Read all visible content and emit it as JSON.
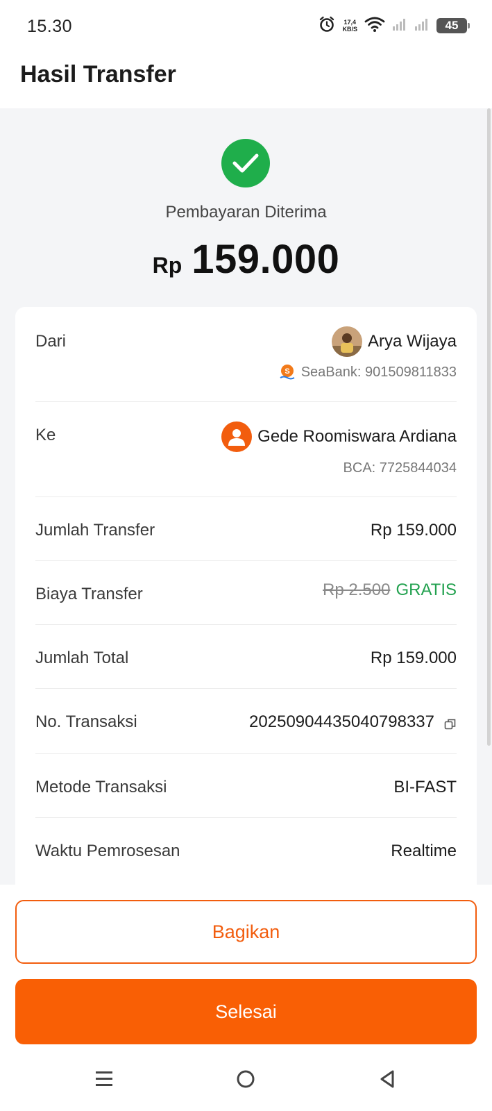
{
  "status_bar": {
    "time": "15.30",
    "net_speed_value": "17,4",
    "net_speed_unit": "KB/S",
    "battery": "45"
  },
  "header": {
    "title": "Hasil Transfer"
  },
  "summary": {
    "status_text": "Pembayaran Diterima",
    "currency": "Rp",
    "amount": "159.000",
    "status_color": "#1fae4b"
  },
  "details": {
    "from": {
      "label": "Dari",
      "name": "Arya Wijaya",
      "account": "SeaBank: 901509811833"
    },
    "to": {
      "label": "Ke",
      "name": "Gede Roomiswara Ardiana",
      "account": "BCA: 7725844034"
    },
    "transfer_amount": {
      "label": "Jumlah Transfer",
      "value": "Rp 159.000"
    },
    "transfer_fee": {
      "label": "Biaya Transfer",
      "original": "Rp 2.500",
      "value": "GRATIS"
    },
    "total_amount": {
      "label": "Jumlah Total",
      "value": "Rp 159.000"
    },
    "transaction_no": {
      "label": "No. Transaksi",
      "value": "20250904435040798337"
    },
    "method": {
      "label": "Metode Transaksi",
      "value": "BI-FAST"
    },
    "processing_time": {
      "label": "Waktu Pemrosesan",
      "value": "Realtime"
    }
  },
  "actions": {
    "share_label": "Bagikan",
    "done_label": "Selesai",
    "accent_color": "#f95f05"
  }
}
